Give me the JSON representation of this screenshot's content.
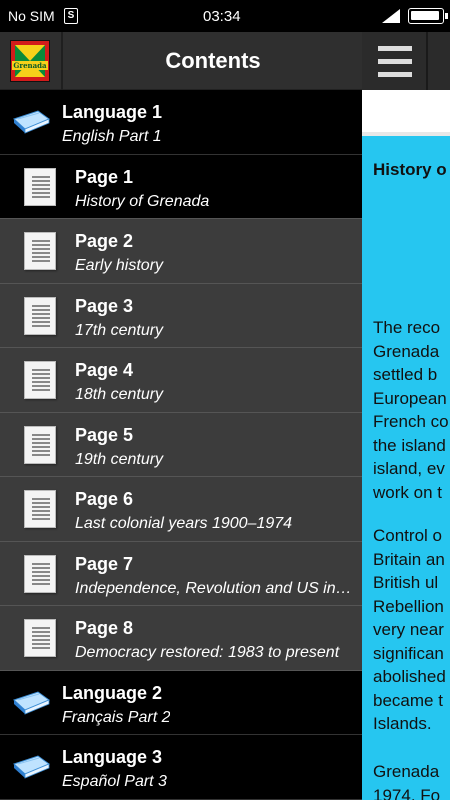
{
  "status_bar": {
    "carrier": "No SIM",
    "sim_badge": "S",
    "time": "03:34"
  },
  "drawer": {
    "title": "Contents",
    "flag_text": "Grenada",
    "items": [
      {
        "kind": "lang",
        "title": "Language 1",
        "subtitle": "English Part 1",
        "icon": "book-icon"
      },
      {
        "kind": "page",
        "title": "Page 1",
        "subtitle": "History of Grenada",
        "icon": "page-icon",
        "selected": true
      },
      {
        "kind": "page",
        "title": "Page 2",
        "subtitle": "Early history",
        "icon": "page-icon"
      },
      {
        "kind": "page",
        "title": "Page 3",
        "subtitle": "17th century",
        "icon": "page-icon"
      },
      {
        "kind": "page",
        "title": "Page 4",
        "subtitle": "18th century",
        "icon": "page-icon"
      },
      {
        "kind": "page",
        "title": "Page 5",
        "subtitle": "19th century",
        "icon": "page-icon"
      },
      {
        "kind": "page",
        "title": "Page 6",
        "subtitle": "Last colonial years 1900–1974",
        "icon": "page-icon"
      },
      {
        "kind": "page",
        "title": "Page 7",
        "subtitle": "Independence, Revolution and US invasion",
        "icon": "page-icon"
      },
      {
        "kind": "page",
        "title": "Page 8",
        "subtitle": "Democracy restored: 1983 to present",
        "icon": "page-icon"
      },
      {
        "kind": "lang",
        "title": "Language 2",
        "subtitle": "Français Part 2",
        "icon": "book-icon"
      },
      {
        "kind": "lang",
        "title": "Language 3",
        "subtitle": "Español Part 3",
        "icon": "book-icon"
      }
    ]
  },
  "content": {
    "doc_title": "History o",
    "paragraphs": [
      [
        "The reco",
        "Grenada",
        "settled b",
        "European",
        "French co",
        "the island",
        "island, ev",
        "work on t"
      ],
      [
        "Control o",
        "Britain an",
        "British ul",
        "Rebellion",
        "very near",
        "significan",
        "abolished",
        "became t",
        "Islands."
      ],
      [
        "Grenada",
        "1974. Fo"
      ]
    ]
  },
  "colors": {
    "accent_cyan": "#26c6f0",
    "drawer_bg": "#3c3c3c",
    "selected_bg": "#000000"
  }
}
